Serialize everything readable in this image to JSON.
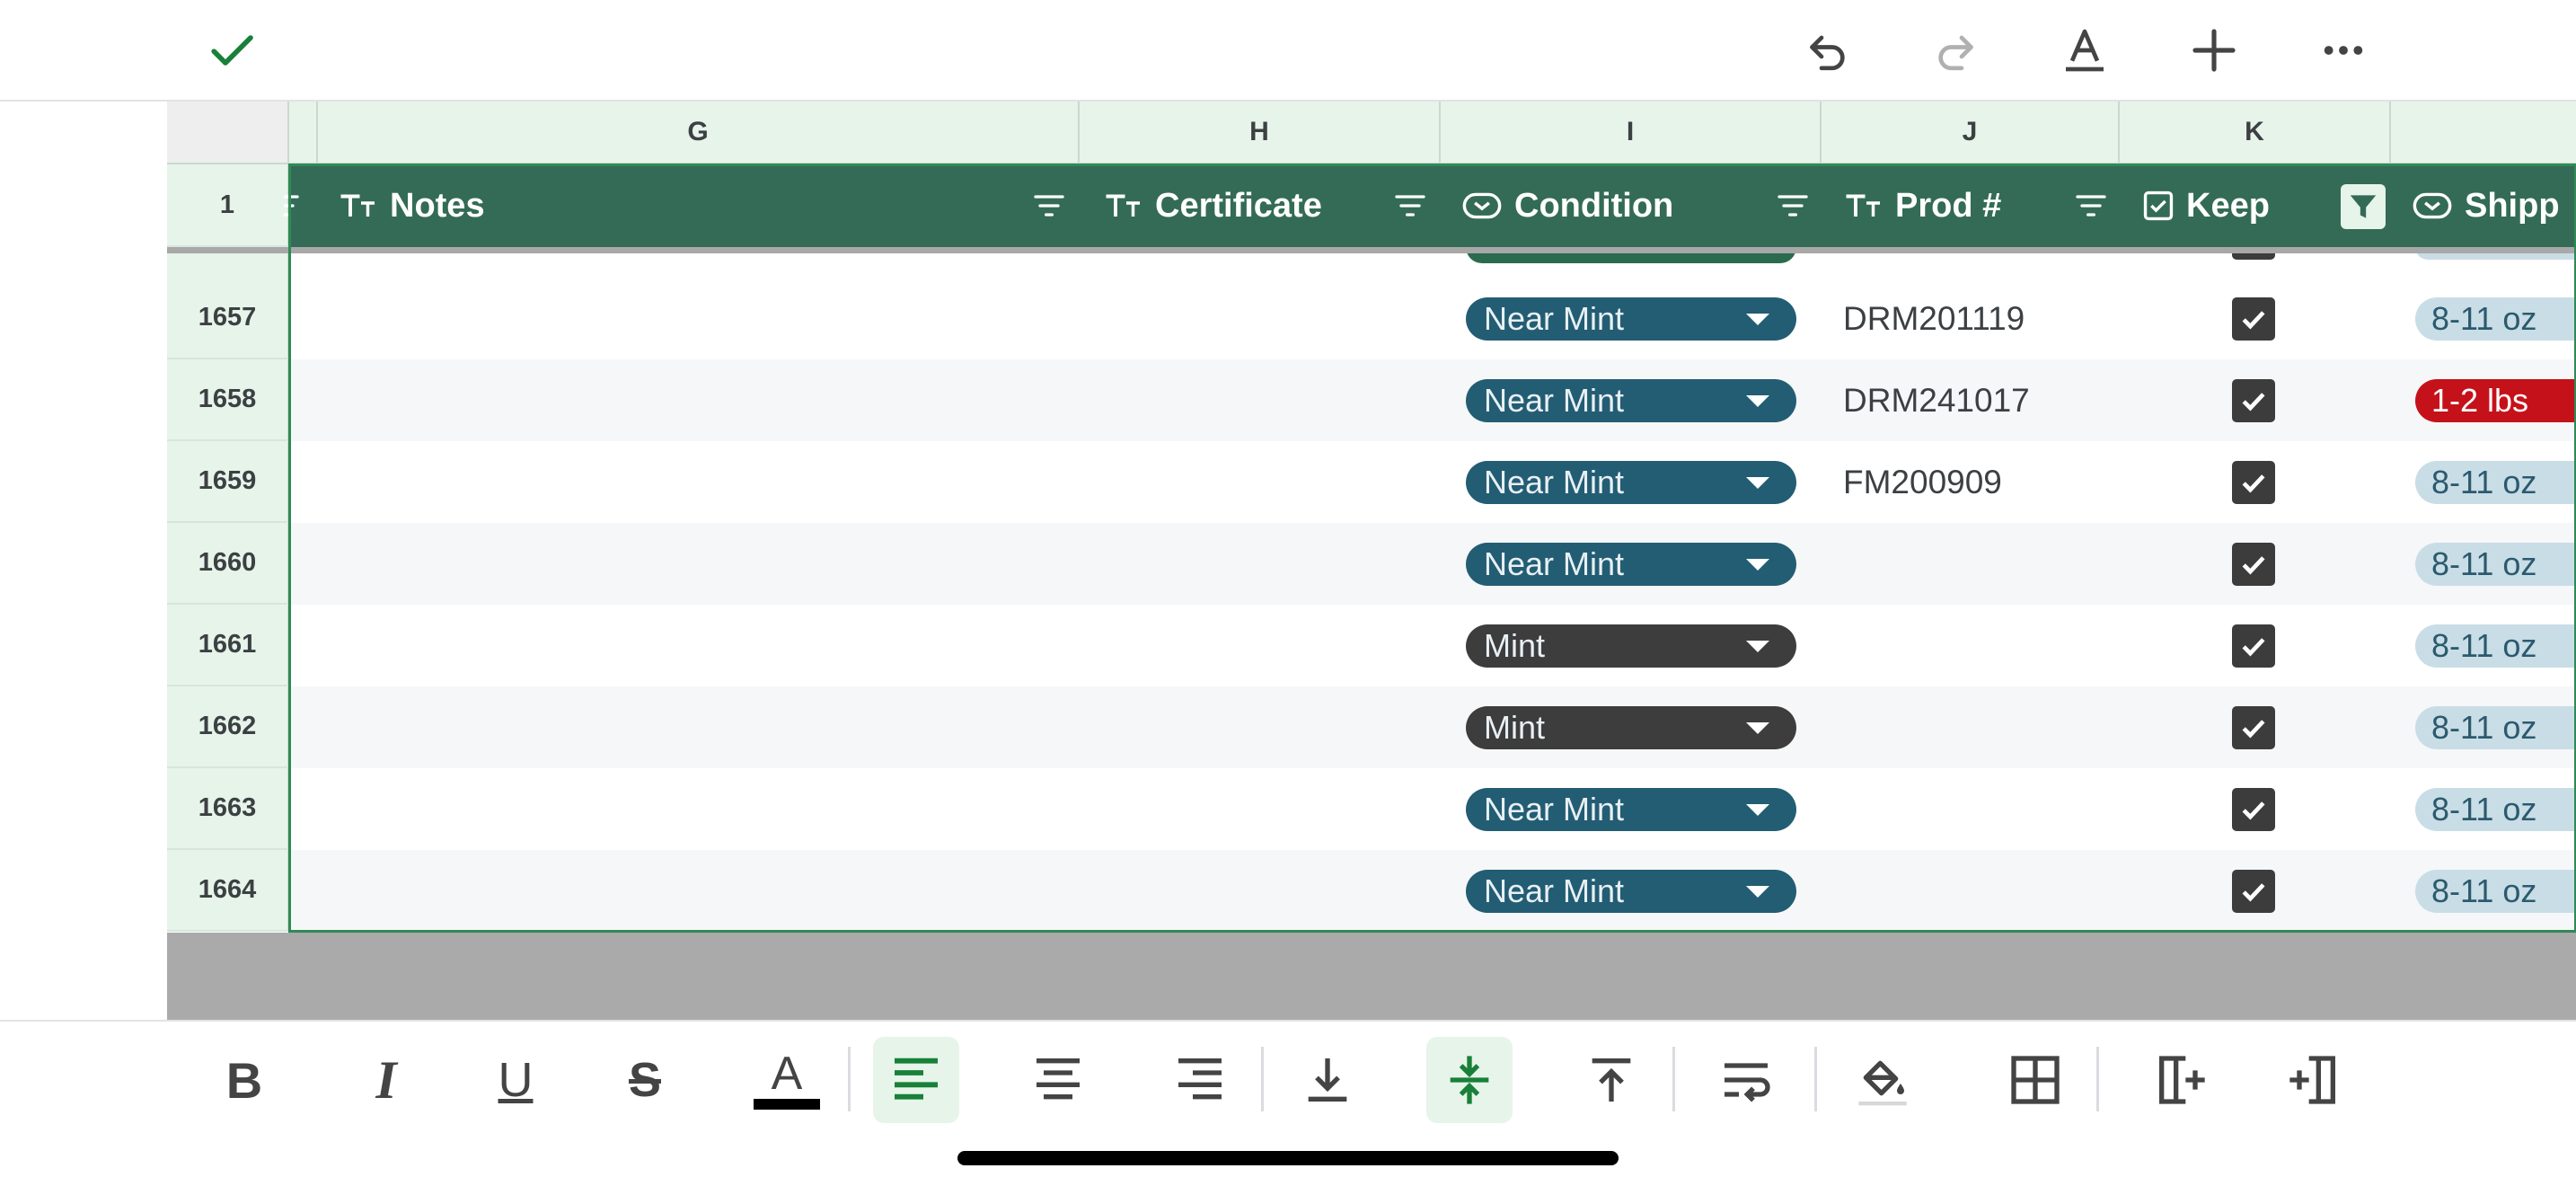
{
  "topbar": {
    "done_icon": "check-icon",
    "undo_icon": "undo-icon",
    "redo_icon": "redo-icon",
    "text_format_icon": "text-format-icon",
    "add_icon": "plus-icon",
    "more_icon": "more-horizontal-icon"
  },
  "columns": [
    "G",
    "H",
    "I",
    "J",
    "K"
  ],
  "header_row": {
    "row_number": "1",
    "fields": [
      {
        "title": "Notes",
        "type_icon": "text-type-icon"
      },
      {
        "title": "Certificate",
        "type_icon": "text-type-icon"
      },
      {
        "title": "Condition",
        "type_icon": "dropdown-type-icon"
      },
      {
        "title": "Prod #",
        "type_icon": "text-type-icon"
      },
      {
        "title": "Keep",
        "type_icon": "checkbox-type-icon"
      },
      {
        "title": "Shipp",
        "type_icon": "dropdown-type-icon"
      }
    ]
  },
  "rows": [
    {
      "row": "1657",
      "condition": "Near Mint",
      "condition_kind": "nm",
      "prod": "DRM201119",
      "keep": true,
      "shipping": "8-11 oz",
      "shipping_kind": "light"
    },
    {
      "row": "1658",
      "condition": "Near Mint",
      "condition_kind": "nm",
      "prod": "DRM241017",
      "keep": true,
      "shipping": "1-2 lbs",
      "shipping_kind": "red"
    },
    {
      "row": "1659",
      "condition": "Near Mint",
      "condition_kind": "nm",
      "prod": "FM200909",
      "keep": true,
      "shipping": "8-11 oz",
      "shipping_kind": "light"
    },
    {
      "row": "1660",
      "condition": "Near Mint",
      "condition_kind": "nm",
      "prod": "",
      "keep": true,
      "shipping": "8-11 oz",
      "shipping_kind": "light"
    },
    {
      "row": "1661",
      "condition": "Mint",
      "condition_kind": "mint",
      "prod": "",
      "keep": true,
      "shipping": "8-11 oz",
      "shipping_kind": "light"
    },
    {
      "row": "1662",
      "condition": "Mint",
      "condition_kind": "mint",
      "prod": "",
      "keep": true,
      "shipping": "8-11 oz",
      "shipping_kind": "light"
    },
    {
      "row": "1663",
      "condition": "Near Mint",
      "condition_kind": "nm",
      "prod": "",
      "keep": true,
      "shipping": "8-11 oz",
      "shipping_kind": "light"
    },
    {
      "row": "1664",
      "condition": "Near Mint",
      "condition_kind": "nm",
      "prod": "",
      "keep": true,
      "shipping": "8-11 oz",
      "shipping_kind": "light"
    }
  ],
  "format_toolbar": {
    "bold_label": "B",
    "italic_label": "I",
    "underline_label": "U",
    "strike_label": "S",
    "text_color_label": "A",
    "items": [
      "bold-icon",
      "italic-icon",
      "underline-icon",
      "strikethrough-icon",
      "text-color-icon",
      "align-left-icon",
      "align-center-icon",
      "align-right-icon",
      "valign-bottom-icon",
      "valign-middle-icon",
      "valign-top-icon",
      "wrap-text-icon",
      "fill-color-icon",
      "borders-icon",
      "insert-column-right-icon",
      "insert-column-left-icon"
    ],
    "active": [
      "align-left-icon",
      "valign-middle-icon"
    ]
  },
  "colors": {
    "accent": "#188038",
    "header_bg": "#336b57",
    "near_mint_chip": "#235d73",
    "mint_chip": "#3d3d3d",
    "shipping_light": "#c9dde6",
    "shipping_red": "#c5121a"
  }
}
